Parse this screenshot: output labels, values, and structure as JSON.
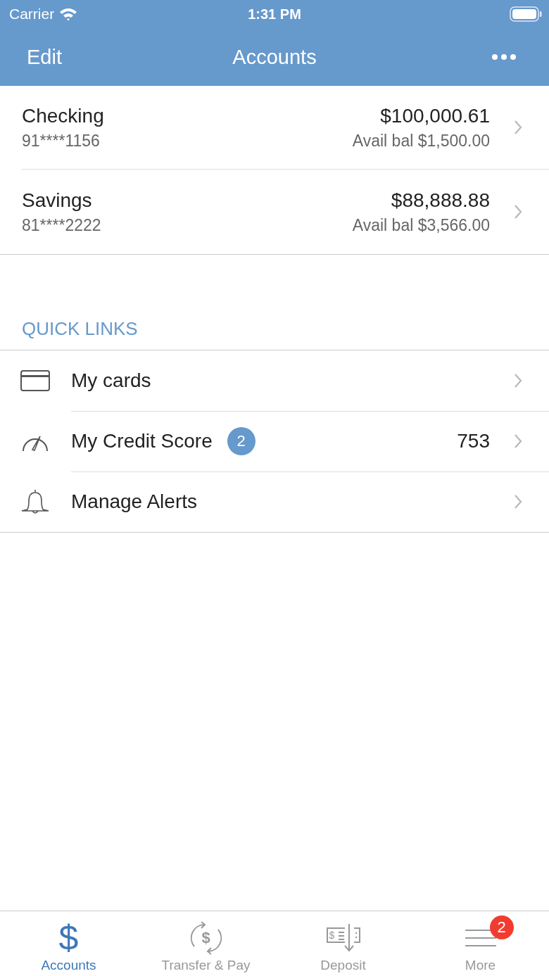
{
  "status_bar": {
    "carrier": "Carrier",
    "time": "1:31 PM"
  },
  "nav": {
    "left": "Edit",
    "title": "Accounts"
  },
  "accounts": [
    {
      "name": "Checking",
      "number": "91****1156",
      "balance": "$100,000.61",
      "available": "Avail bal $1,500.00"
    },
    {
      "name": "Savings",
      "number": "81****2222",
      "balance": "$88,888.88",
      "available": "Avail bal $3,566.00"
    }
  ],
  "quick_links": {
    "heading": "QUICK LINKS",
    "items": [
      {
        "kind": "card",
        "label": "My cards"
      },
      {
        "kind": "gauge",
        "label": "My Credit Score",
        "badge": "2",
        "value": "753"
      },
      {
        "kind": "bell",
        "label": "Manage Alerts"
      }
    ]
  },
  "tab_bar": [
    {
      "kind": "dollar",
      "glyph": "$",
      "label": "Accounts",
      "selected": true
    },
    {
      "kind": "transfer",
      "glyph": "$",
      "label": "Transfer & Pay",
      "selected": false
    },
    {
      "kind": "check",
      "glyph": "$",
      "label": "Deposit",
      "selected": false
    },
    {
      "kind": "menu",
      "label": "More",
      "badge": "2",
      "selected": false
    }
  ]
}
